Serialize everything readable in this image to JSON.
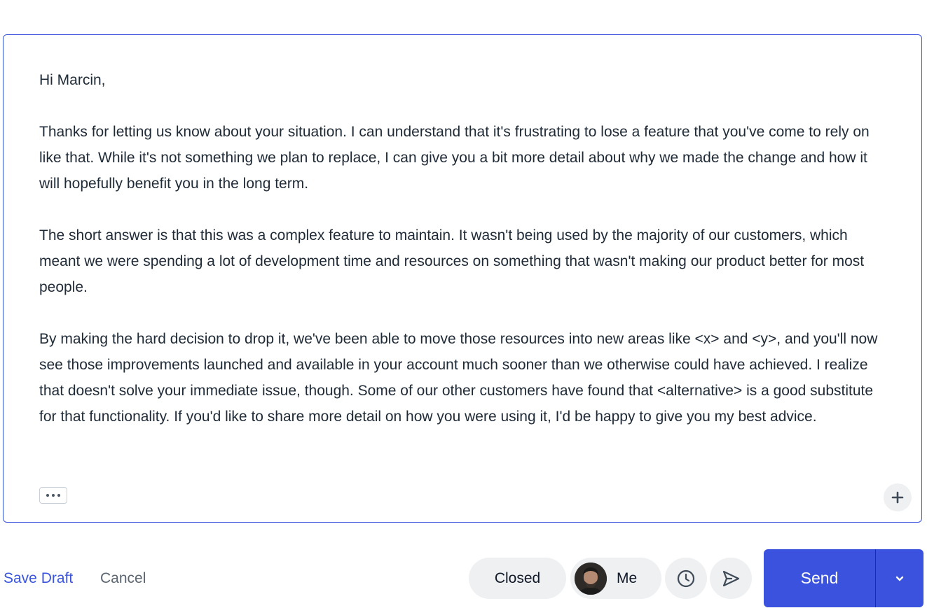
{
  "message": {
    "paragraphs": [
      "Hi Marcin,",
      "Thanks for letting us know about your situation. I can understand that it's frustrating to lose a feature that you've come to rely on like that. While it's not something we plan to replace, I can give you a bit more detail about why we made the change and how it will hopefully benefit you in the long term.",
      "The short answer is that this was a complex feature to maintain. It wasn't being used by the majority of our customers, which meant we were spending a lot of development time and resources on something that wasn't making our product better for most people.",
      "By making the hard decision to drop it, we've been able to move those resources into new areas like <x> and <y>, and you'll now see those improvements launched and available in your account much sooner than we otherwise could have achieved. I realize that doesn't solve your immediate issue, though. Some of our other customers have found that <alternative> is a good substitute for that functionality. If you'd like to share more detail on how you were using it, I'd be happy to give you my best advice."
    ]
  },
  "toolbar": {
    "more_icon": "ellipsis-icon",
    "add_icon": "plus-icon"
  },
  "footer": {
    "save_draft_label": "Save Draft",
    "cancel_label": "Cancel",
    "status_label": "Closed",
    "assignee_label": "Me",
    "snooze_icon": "clock-icon",
    "send_later_icon": "paper-plane-icon",
    "send_label": "Send",
    "send_options_icon": "chevron-down-icon"
  },
  "colors": {
    "accent": "#3a52dd",
    "link": "#3a56e0",
    "pill_bg": "#eef0f2"
  }
}
